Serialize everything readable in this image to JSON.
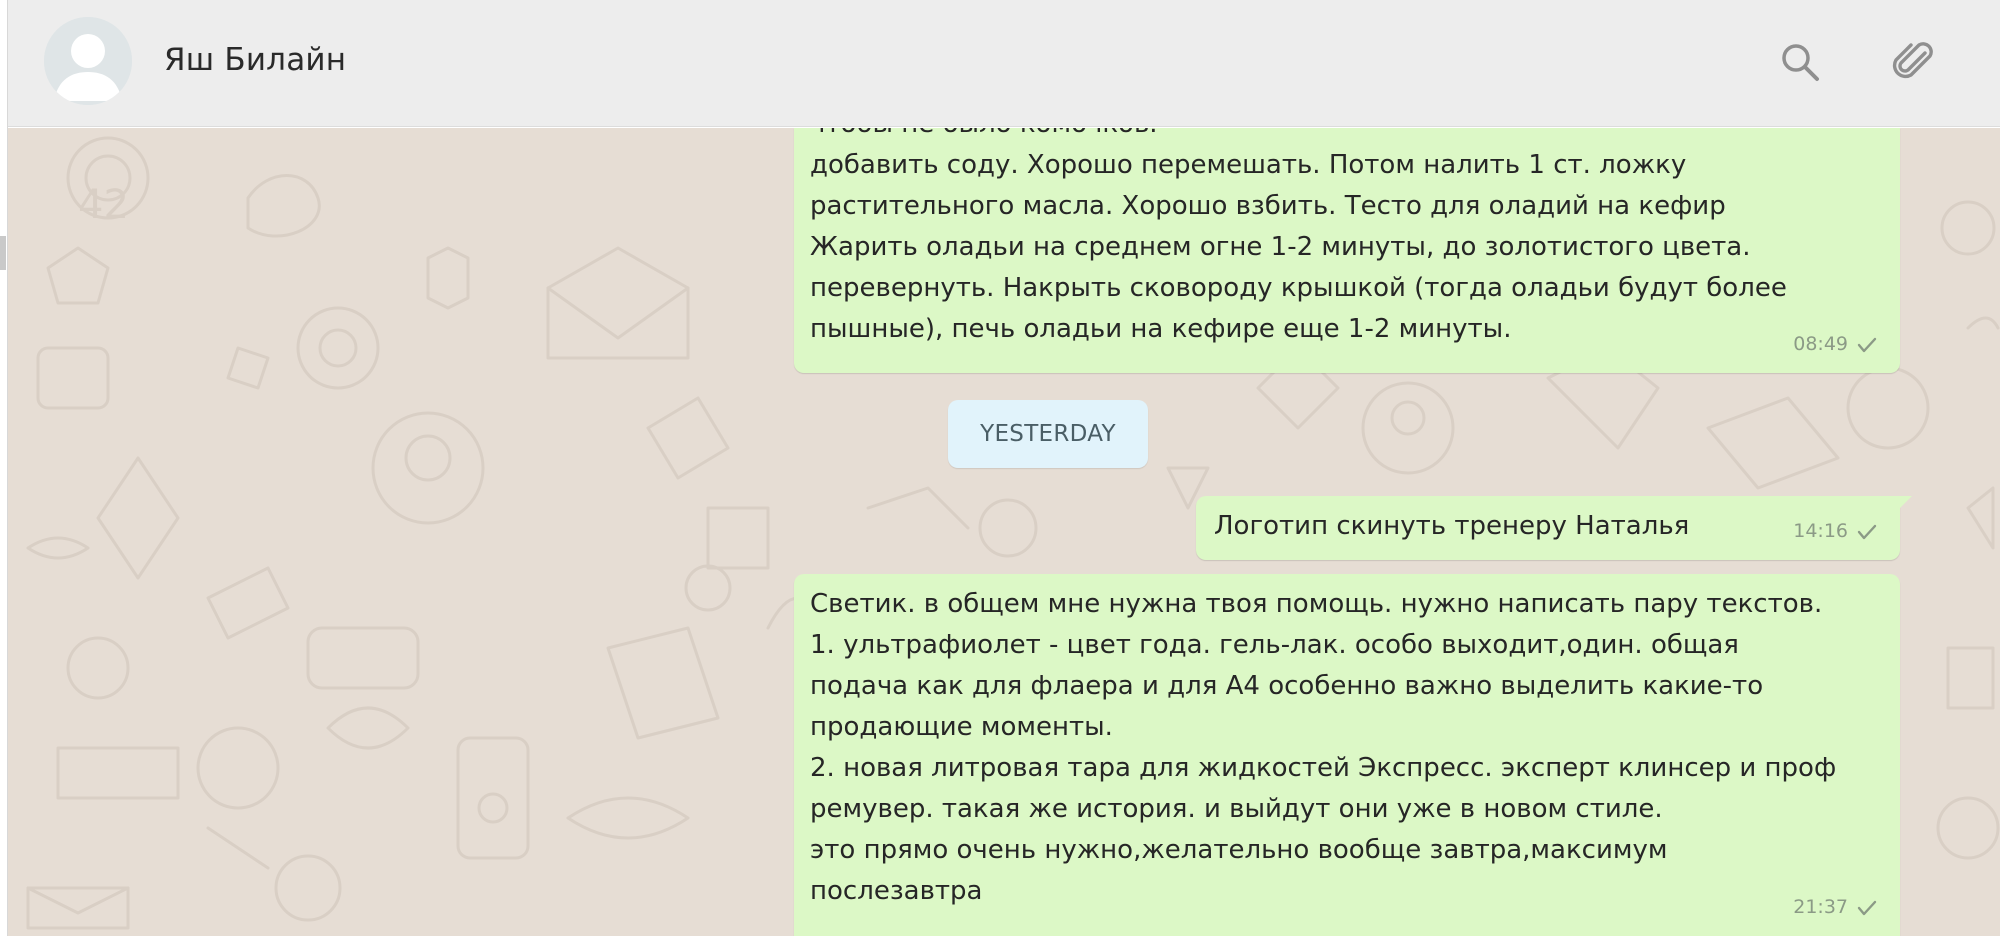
{
  "header": {
    "contact_name": "Яш Билайн",
    "avatar_icon": "default-avatar-icon",
    "search_icon": "search-icon",
    "attach_icon": "paperclip-icon"
  },
  "colors": {
    "header_bg": "#ededed",
    "chat_bg": "#e6ddd4",
    "outgoing_bubble": "#dcf8c6",
    "date_chip": "#e1f3fb",
    "tick": "#8b9a86"
  },
  "messages": [
    {
      "text": "чтобы не было комочков.\nдобавить соду. Хорошо перемешать. Потом налить 1 ст. ложку\nрастительного масла. Хорошо взбить. Тесто для оладий на кефир\nЖарить оладьи на среднем огне 1-2 минуты, до золотистого цвета.\nперевернуть. Накрыть сковороду крышкой (тогда оладьи будут более\nпышные), печь оладьи на кефире еще 1-2 минуты.",
      "time": "08:49",
      "status_icon": "single-check-icon"
    },
    {
      "text": "Логотип скинуть тренеру Наталья",
      "time": "14:16",
      "status_icon": "single-check-icon"
    },
    {
      "text": "Светик. в общем мне нужна твоя помощь. нужно написать пару текстов.\n1. ультрафиолет - цвет года. гель-лак. особо выходит,один. общая\nподача как для флаера и для А4 особенно важно выделить какие-то\nпродающие моменты.\n2. новая литровая тара для жидкостей Экспресс. эксперт клинсер и проф\nремувер. такая же история. и выйдут они уже в новом стиле.\nэто прямо очень нужно,желательно вообще завтра,максимум\nпослезавтра",
      "time": "21:37",
      "status_icon": "single-check-icon"
    }
  ],
  "date_separator": "YESTERDAY"
}
